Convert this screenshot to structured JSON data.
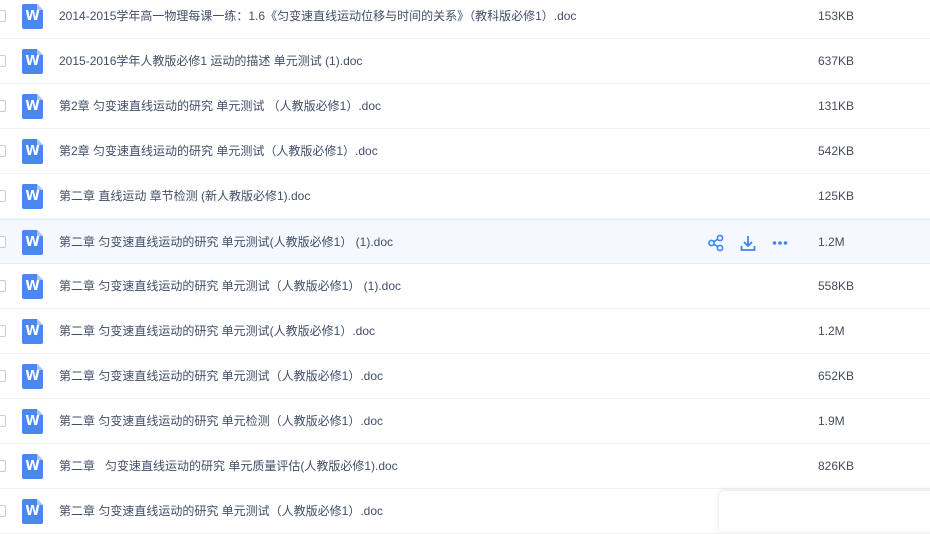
{
  "icon_letter": "W",
  "accent_color": "#4a87ee",
  "hover_actions": [
    {
      "icon": "share-icon"
    },
    {
      "icon": "download-icon"
    },
    {
      "icon": "more-icon"
    }
  ],
  "files": [
    {
      "name": "2014-2015学年高一物理每课一练：1.6《匀变速直线运动位移与时间的关系》（教科版必修1）.doc",
      "size": "153KB"
    },
    {
      "name": "2015-2016学年人教版必修1 运动的描述 单元测试 (1).doc",
      "size": "637KB"
    },
    {
      "name": "第2章 匀变速直线运动的研究 单元测试 （人教版必修1）.doc",
      "size": "131KB"
    },
    {
      "name": "第2章 匀变速直线运动的研究 单元测试（人教版必修1）.doc",
      "size": "542KB"
    },
    {
      "name": "第二章 直线运动 章节检测 (新人教版必修1).doc",
      "size": "125KB"
    },
    {
      "name": "第二章 匀变速直线运动的研究 单元测试(人教版必修1） (1).doc",
      "size": "1.2M",
      "hovered": true
    },
    {
      "name": "第二章 匀变速直线运动的研究 单元测试（人教版必修1） (1).doc",
      "size": "558KB"
    },
    {
      "name": "第二章 匀变速直线运动的研究 单元测试(人教版必修1）.doc",
      "size": "1.2M"
    },
    {
      "name": "第二章 匀变速直线运动的研究 单元测试（人教版必修1）.doc",
      "size": "652KB"
    },
    {
      "name": "第二章 匀变速直线运动的研究 单元检测（人教版必修1）.doc",
      "size": "1.9M"
    },
    {
      "name": "第二章   匀变速直线运动的研究 单元质量评估(人教版必修1).doc",
      "size": "826KB"
    },
    {
      "name": "第二章 匀变速直线运动的研究 单元测试（人教版必修1）.doc",
      "size": ""
    }
  ]
}
